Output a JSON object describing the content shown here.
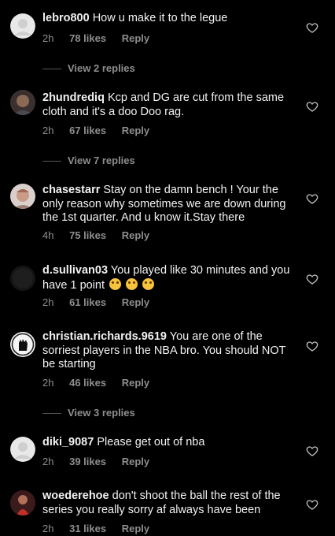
{
  "comments": [
    {
      "username": "lebro800",
      "text": "How u make it to the legue",
      "time": "2h",
      "likes": "78 likes",
      "reply": "Reply",
      "view_replies": "View 2 replies"
    },
    {
      "username": "2hundrediq",
      "text": "Kcp and DG are cut from the same cloth and it's a doo Doo rag.",
      "time": "2h",
      "likes": "67 likes",
      "reply": "Reply",
      "view_replies": "View 7 replies"
    },
    {
      "username": "chasestarr",
      "text": "Stay on the damn bench ! Your the only reason why sometimes we are down during the 1st quarter. And u know it.Stay there",
      "time": "4h",
      "likes": "75 likes",
      "reply": "Reply"
    },
    {
      "username": "d.sullivan03",
      "text": "You played like 30 minutes and you have 1 point",
      "time": "2h",
      "likes": "61 likes",
      "reply": "Reply",
      "emoji_icons": [
        "crying-laughing-icon",
        "crying-laughing-icon",
        "crying-laughing-icon"
      ]
    },
    {
      "username": "christian.richards.9619",
      "text": "You are one of the sorriest players in the NBA bro. You should NOT be starting",
      "time": "2h",
      "likes": "46 likes",
      "reply": "Reply",
      "view_replies": "View 3 replies"
    },
    {
      "username": "diki_9087",
      "text": "Please get out of nba",
      "time": "2h",
      "likes": "39 likes",
      "reply": "Reply"
    },
    {
      "username": "woederehoe",
      "text": "don't shoot the ball the rest of the series you really sorry af always have been",
      "time": "2h",
      "likes": "31 likes",
      "reply": "Reply"
    }
  ],
  "colors": {
    "background": "#000000",
    "text": "#f2f2f2",
    "muted": "#8e8e8e"
  }
}
